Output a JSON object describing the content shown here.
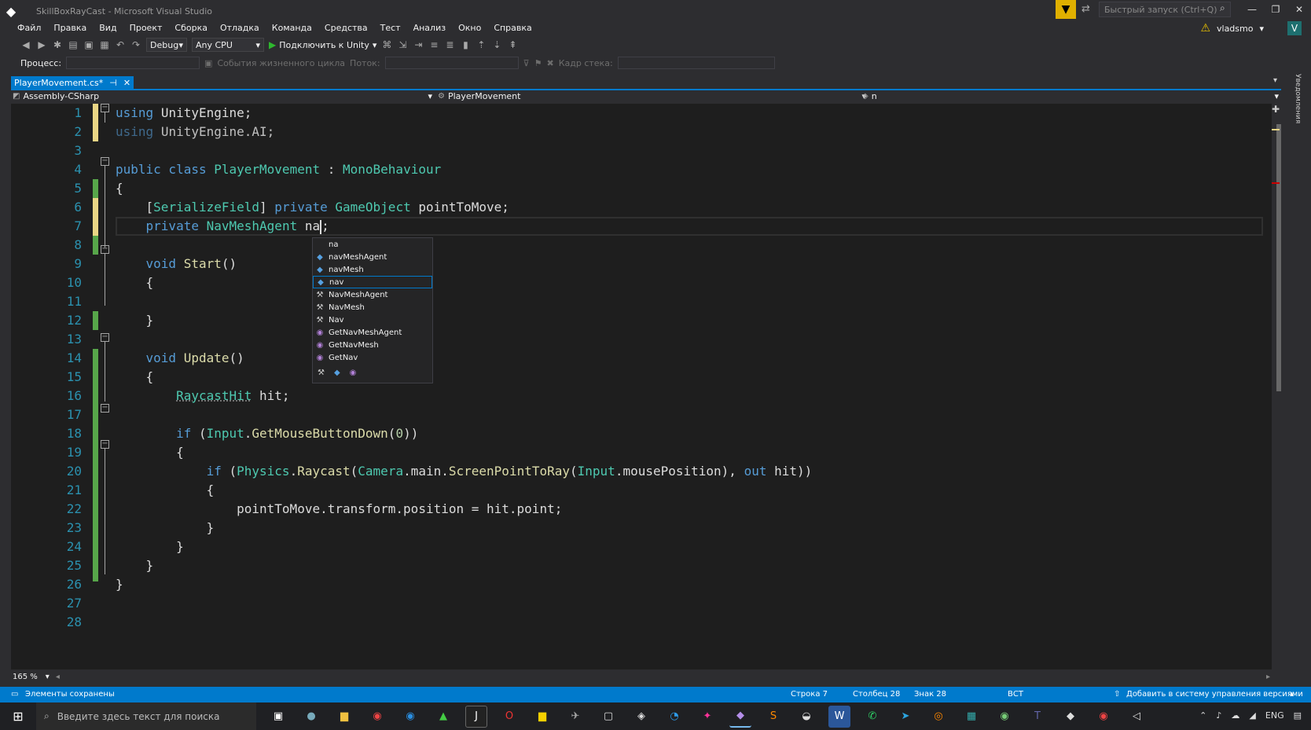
{
  "window": {
    "title": "SkillBoxRayCast - Microsoft Visual Studio",
    "quick_launch_placeholder": "Быстрый запуск (Ctrl+Q)",
    "user": "vladsmo",
    "avatar_letter": "V"
  },
  "menu": [
    "Файл",
    "Правка",
    "Вид",
    "Проект",
    "Сборка",
    "Отладка",
    "Команда",
    "Средства",
    "Тест",
    "Анализ",
    "Окно",
    "Справка"
  ],
  "toolbar": {
    "configuration": "Debug",
    "platform": "Any CPU",
    "attach_label": "Подключить к Unity"
  },
  "debug_bar": {
    "process_label": "Процесс:",
    "lifecycle_label": "События жизненного цикла",
    "thread_label": "Поток:",
    "stack_label": "Кадр стека:"
  },
  "tab": {
    "label": "PlayerMovement.cs*"
  },
  "navbar": {
    "project": "Assembly-CSharp",
    "class": "PlayerMovement",
    "member": "n"
  },
  "code": {
    "line_numbers": [
      "1",
      "2",
      "3",
      "4",
      "5",
      "6",
      "7",
      "8",
      "9",
      "10",
      "11",
      "12",
      "13",
      "14",
      "15",
      "16",
      "17",
      "18",
      "19",
      "20",
      "21",
      "22",
      "23",
      "24",
      "25",
      "26",
      "27",
      "28"
    ],
    "lines": [
      "using UnityEngine;",
      "using UnityEngine.AI;",
      "",
      "public class PlayerMovement : MonoBehaviour",
      "{",
      "    [SerializeField] private GameObject pointToMove;",
      "    private NavMeshAgent na;",
      "",
      "    void Start()",
      "    {",
      "",
      "    }",
      "",
      "    void Update()",
      "    {",
      "        RaycastHit hit;",
      "",
      "        if (Input.GetMouseButtonDown(0))",
      "        {",
      "            if (Physics.Raycast(Camera.main.ScreenPointToRay(Input.mousePosition), out hit))",
      "            {",
      "                pointToMove.transform.position = hit.point;",
      "            }",
      "        }",
      "    }",
      "}",
      "",
      ""
    ],
    "current_line": 7
  },
  "intellisense": {
    "items": [
      {
        "label": "na",
        "icon": "none"
      },
      {
        "label": "navMeshAgent",
        "icon": "field-icon"
      },
      {
        "label": "navMesh",
        "icon": "field-icon"
      },
      {
        "label": "nav",
        "icon": "field-icon",
        "selected": true
      },
      {
        "label": "NavMeshAgent",
        "icon": "wrench-icon"
      },
      {
        "label": "NavMesh",
        "icon": "wrench-icon"
      },
      {
        "label": "Nav",
        "icon": "wrench-icon"
      },
      {
        "label": "GetNavMeshAgent",
        "icon": "method-icon"
      },
      {
        "label": "GetNavMesh",
        "icon": "method-icon"
      },
      {
        "label": "GetNav",
        "icon": "method-icon"
      }
    ]
  },
  "zoom": "165 %",
  "status": {
    "message": "Элементы сохранены",
    "line": "Строка 7",
    "column": "Столбец 28",
    "char": "Знак 28",
    "mode": "ВСТ",
    "source_control": "Добавить в систему управления версиями"
  },
  "right_rail_label": "Уведомления",
  "taskbar": {
    "search_placeholder": "Введите здесь текст для поиска",
    "language": "ENG"
  },
  "colors": {
    "accent": "#007acc",
    "editor_bg": "#1e1e1e",
    "keyword": "#569cd6",
    "type": "#4ec9b0",
    "line_number": "#2b91af"
  }
}
